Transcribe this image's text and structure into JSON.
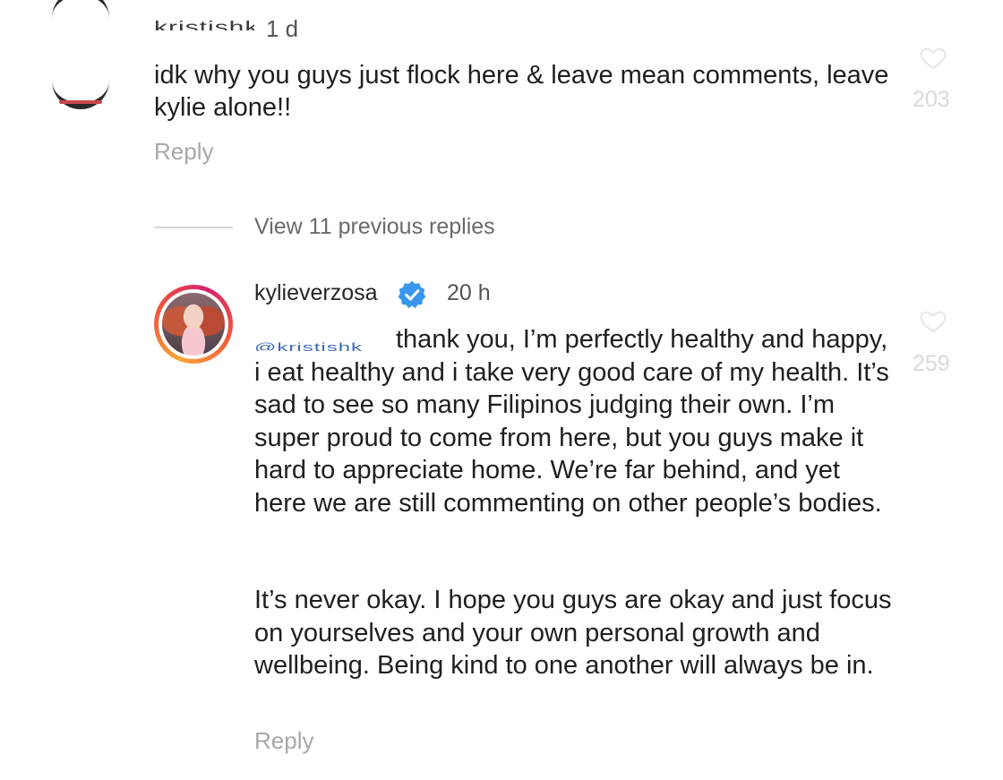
{
  "top_comment": {
    "username": "kristishk",
    "time": "1 d",
    "text": "idk why you guys just flock here & leave mean comments, leave kylie alone!!",
    "reply_label": "Reply",
    "like_count": "203",
    "icons": {
      "avatar": "avatar",
      "like": "heart-icon"
    }
  },
  "view_replies": {
    "label": "View 11 previous replies"
  },
  "reply_comment": {
    "username": "kylieverzosa",
    "verified": true,
    "time": "20 h",
    "mention": "@kristishk",
    "paragraph_1": "thank you, I’m perfectly healthy and happy, i eat healthy and i take very good care of my health. It’s sad to see so many Filipinos judging their own. I’m super proud to come from here, but you guys make it hard to appreciate home. We’re far behind, and yet here we are still commenting on other people’s bodies.",
    "paragraph_2": "It’s never okay. I hope you guys are okay and just focus on yourselves and your own personal growth and wellbeing. Being kind to one another will always be in.",
    "reply_label": "Reply",
    "like_count": "259",
    "icons": {
      "verified": "verified-badge-icon",
      "like": "heart-icon",
      "avatar": "story-ring-avatar"
    },
    "colors": {
      "verified": "#3897f0",
      "mention": "#3c6ab8"
    }
  }
}
